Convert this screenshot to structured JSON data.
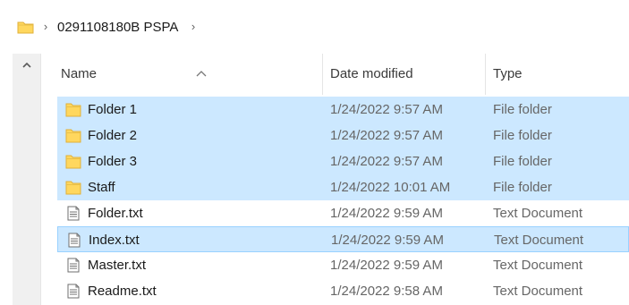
{
  "address_bar": {
    "folder_icon": "folder-icon",
    "crumbs": [
      "0291108180B PSPA"
    ]
  },
  "columns": {
    "name": "Name",
    "date": "Date modified",
    "type": "Type"
  },
  "files": [
    {
      "name": "Folder 1",
      "date": "1/24/2022 9:57 AM",
      "type": "File folder",
      "icon": "folder-icon",
      "selected": true
    },
    {
      "name": "Folder 2",
      "date": "1/24/2022 9:57 AM",
      "type": "File folder",
      "icon": "folder-icon",
      "selected": true
    },
    {
      "name": "Folder 3",
      "date": "1/24/2022 9:57 AM",
      "type": "File folder",
      "icon": "folder-icon",
      "selected": true
    },
    {
      "name": "Staff",
      "date": "1/24/2022 10:01 AM",
      "type": "File folder",
      "icon": "folder-icon",
      "selected": true
    },
    {
      "name": "Folder.txt",
      "date": "1/24/2022 9:59 AM",
      "type": "Text Document",
      "icon": "text-document-icon",
      "selected": false
    },
    {
      "name": "Index.txt",
      "date": "1/24/2022 9:59 AM",
      "type": "Text Document",
      "icon": "text-document-icon",
      "selected": true
    },
    {
      "name": "Master.txt",
      "date": "1/24/2022 9:59 AM",
      "type": "Text Document",
      "icon": "text-document-icon",
      "selected": false
    },
    {
      "name": "Readme.txt",
      "date": "1/24/2022 9:58 AM",
      "type": "Text Document",
      "icon": "text-document-icon",
      "selected": false
    }
  ],
  "colors": {
    "selection": "#cce8ff",
    "selection_border": "#99d1ff",
    "folder": "#ffd75e"
  }
}
